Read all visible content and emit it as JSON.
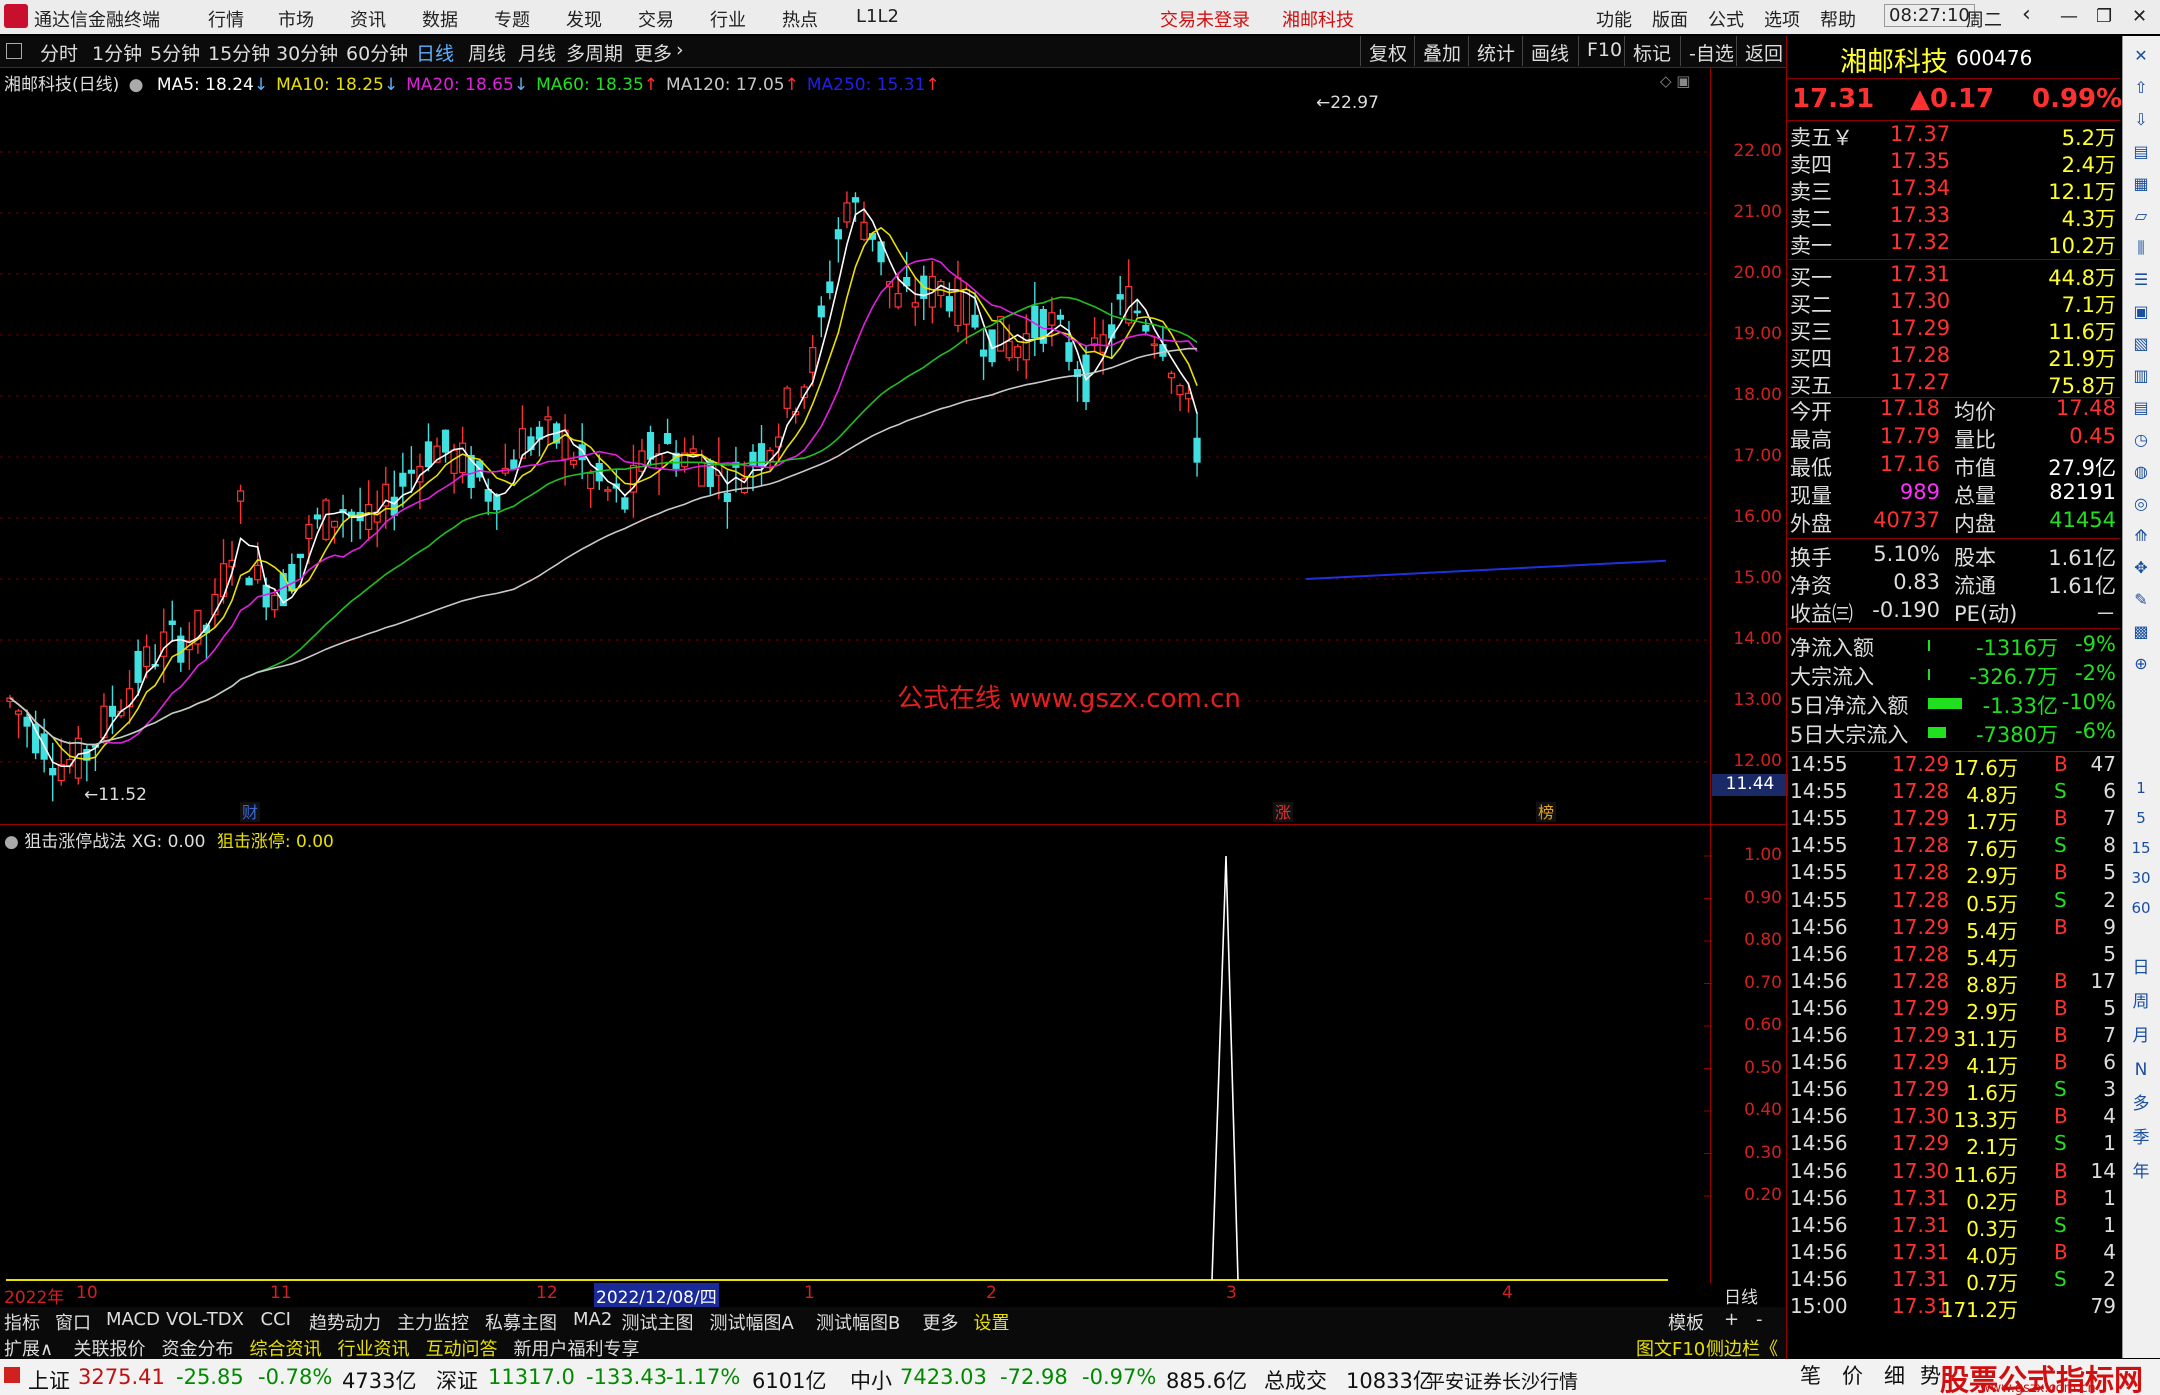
{
  "app": {
    "title": "通达信金融终端",
    "menu": [
      "行情",
      "市场",
      "资讯",
      "数据",
      "专题",
      "发现",
      "交易",
      "行业",
      "热点",
      "L1L2"
    ],
    "trade_status": "交易未登录",
    "stock_title": "湘邮科技",
    "right_menu": [
      "功能",
      "版面",
      "公式",
      "选项",
      "帮助"
    ],
    "time": "08:27:10",
    "weekday": "周二"
  },
  "periods": [
    "分时",
    "1分钟",
    "5分钟",
    "15分钟",
    "30分钟",
    "60分钟",
    "日线",
    "周线",
    "月线",
    "多周期",
    "更多"
  ],
  "active_period": "日线",
  "tools": [
    "复权",
    "叠加",
    "统计",
    "画线",
    "F10",
    "标记",
    "-自选",
    "返回"
  ],
  "main_chart": {
    "title": "湘邮科技(日线)",
    "ma": [
      {
        "label": "MA5: 18.24",
        "color": "#ffffff",
        "arrow": "↓"
      },
      {
        "label": "MA10: 18.25",
        "color": "#e8e000",
        "arrow": "↓"
      },
      {
        "label": "MA20: 18.65",
        "color": "#e020e0",
        "arrow": "↓"
      },
      {
        "label": "MA60: 18.35",
        "color": "#20e020",
        "arrow": "↑"
      },
      {
        "label": "MA120: 17.05",
        "color": "#c8c8c8",
        "arrow": "↑"
      },
      {
        "label": "MA250: 15.31",
        "color": "#2020e8",
        "arrow": "↑"
      }
    ],
    "high_label": "22.97",
    "low_label": "11.52",
    "price_tag": "11.44",
    "watermark": "公式在线  www.gszx.com.cn",
    "markers": [
      {
        "text": "财",
        "color": "#3a6ad8"
      },
      {
        "text": "涨",
        "color": "#e03030"
      },
      {
        "text": "榜",
        "color": "#e0a020"
      }
    ],
    "ylabels": [
      "22.00",
      "21.00",
      "20.00",
      "19.00",
      "18.00",
      "17.00",
      "16.00",
      "15.00",
      "14.00",
      "13.00",
      "12.00"
    ]
  },
  "sub_chart": {
    "title": "狙击涨停战法",
    "xg": "XG: 0.00",
    "signal": "狙击涨停: 0.00",
    "ylabels": [
      "1.00",
      "0.90",
      "0.80",
      "0.70",
      "0.60",
      "0.50",
      "0.40",
      "0.30",
      "0.20"
    ]
  },
  "xaxis": {
    "labels": [
      "2022年",
      "10",
      "11",
      "12",
      "2022/12/08/四",
      "1",
      "2",
      "3",
      "4"
    ],
    "right": "日线"
  },
  "tabs1": [
    "指标",
    "窗口",
    "MACD",
    "VOL-TDX",
    "CCI",
    "趋势动力",
    "主力监控",
    "私募主图",
    "MA2",
    "测试主图",
    "测试幅图A",
    "测试幅图B",
    "更多",
    "设置"
  ],
  "tabs1_right": [
    "模板",
    "+",
    "-"
  ],
  "tabs2": [
    "扩展∧",
    "关联报价",
    "资金分布",
    "综合资讯",
    "行业资讯",
    "互动问答",
    "新用户福利专享"
  ],
  "tabs2_right": [
    "图文F10",
    "侧边栏《",
    "笔",
    "价",
    "细",
    "势"
  ],
  "quote": {
    "name": "湘邮科技",
    "code": "600476",
    "price": "17.31",
    "change": "▲0.17",
    "pct": "0.99%",
    "sell": [
      {
        "l": "卖五￥",
        "p": "17.37",
        "v": "5.2万"
      },
      {
        "l": "卖四",
        "p": "17.35",
        "v": "2.4万"
      },
      {
        "l": "卖三",
        "p": "17.34",
        "v": "12.1万"
      },
      {
        "l": "卖二",
        "p": "17.33",
        "v": "4.3万"
      },
      {
        "l": "卖一",
        "p": "17.32",
        "v": "10.2万"
      }
    ],
    "buy": [
      {
        "l": "买一",
        "p": "17.31",
        "v": "44.8万"
      },
      {
        "l": "买二",
        "p": "17.30",
        "v": "7.1万"
      },
      {
        "l": "买三",
        "p": "17.29",
        "v": "11.6万"
      },
      {
        "l": "买四",
        "p": "17.28",
        "v": "21.9万"
      },
      {
        "l": "买五",
        "p": "17.27",
        "v": "75.8万"
      }
    ],
    "stats": [
      {
        "a": "今开",
        "b": "17.18",
        "c": "均价",
        "d": "17.48",
        "bc": "#ff3030",
        "dc": "#ff3030"
      },
      {
        "a": "最高",
        "b": "17.79",
        "c": "量比",
        "d": "0.45",
        "bc": "#ff3030",
        "dc": "#ff3030"
      },
      {
        "a": "最低",
        "b": "17.16",
        "c": "市值",
        "d": "27.9亿",
        "bc": "#ff3030",
        "dc": "#ffffff"
      },
      {
        "a": "现量",
        "b": "989",
        "c": "总量",
        "d": "82191",
        "bc": "#ff30ff",
        "dc": "#ffffff"
      },
      {
        "a": "外盘",
        "b": "40737",
        "c": "内盘",
        "d": "41454",
        "bc": "#ff3030",
        "dc": "#20e020"
      }
    ],
    "stats2": [
      {
        "a": "换手",
        "b": "5.10%",
        "c": "股本",
        "d": "1.61亿"
      },
      {
        "a": "净资",
        "b": "0.83",
        "c": "流通",
        "d": "1.61亿"
      },
      {
        "a": "收益㈢",
        "b": "-0.190",
        "c": "PE(动)",
        "d": "－"
      }
    ],
    "flow": [
      {
        "a": "净流入额",
        "v": "-1316万",
        "p": "-9%",
        "bar": 2
      },
      {
        "a": "大宗流入",
        "v": "-326.7万",
        "p": "-2%",
        "bar": 2
      },
      {
        "a": "5日净流入额",
        "v": "-1.33亿",
        "p": "-10%",
        "bar": 34
      },
      {
        "a": "5日大宗流入",
        "v": "-7380万",
        "p": "-6%",
        "bar": 18
      }
    ],
    "ticks": [
      [
        "14:55",
        "17.29",
        "17.6万",
        "B",
        "47"
      ],
      [
        "14:55",
        "17.28",
        "4.8万",
        "S",
        "6"
      ],
      [
        "14:55",
        "17.29",
        "1.7万",
        "B",
        "7"
      ],
      [
        "14:55",
        "17.28",
        "7.6万",
        "S",
        "8"
      ],
      [
        "14:55",
        "17.28",
        "2.9万",
        "B",
        "5"
      ],
      [
        "14:55",
        "17.28",
        "0.5万",
        "S",
        "2"
      ],
      [
        "14:56",
        "17.29",
        "5.4万",
        "B",
        "9"
      ],
      [
        "14:56",
        "17.28",
        "5.4万",
        "",
        "5"
      ],
      [
        "14:56",
        "17.28",
        "8.8万",
        "B",
        "17"
      ],
      [
        "14:56",
        "17.29",
        "2.9万",
        "B",
        "5"
      ],
      [
        "14:56",
        "17.29",
        "31.1万",
        "B",
        "7"
      ],
      [
        "14:56",
        "17.29",
        "4.1万",
        "B",
        "6"
      ],
      [
        "14:56",
        "17.29",
        "1.6万",
        "S",
        "3"
      ],
      [
        "14:56",
        "17.30",
        "13.3万",
        "B",
        "4"
      ],
      [
        "14:56",
        "17.29",
        "2.1万",
        "S",
        "1"
      ],
      [
        "14:56",
        "17.30",
        "11.6万",
        "B",
        "14"
      ],
      [
        "14:56",
        "17.31",
        "0.2万",
        "B",
        "1"
      ],
      [
        "14:56",
        "17.31",
        "0.3万",
        "S",
        "1"
      ],
      [
        "14:56",
        "17.31",
        "4.0万",
        "B",
        "4"
      ],
      [
        "14:56",
        "17.31",
        "0.7万",
        "S",
        "2"
      ],
      [
        "15:00",
        "17.31",
        "171.2万",
        "",
        "79"
      ]
    ]
  },
  "strip": [
    "日",
    "周",
    "月",
    "N",
    "多",
    "季",
    "年"
  ],
  "strip_nums": [
    "1",
    "5",
    "15",
    "30",
    "60"
  ],
  "status": {
    "sh_name": "上证",
    "sh": "3275.41",
    "sh_chg": "-25.85",
    "sh_pct": "-0.78%",
    "sh_amt": "4733亿",
    "sz_name": "深证",
    "sz": "11317.0",
    "sz_chg": "-133.43",
    "sz_pct": "-1.17%",
    "sz_amt": "6101亿",
    "zx_name": "中小",
    "zx": "7423.03",
    "zx_chg": "-72.98",
    "zx_pct": "-0.97%",
    "zx_amt": "885.6亿",
    "total_label": "总成交",
    "total": "10833亿",
    "broker": "平安证券长沙行情",
    "brand": "股票公式指标网",
    "brand_url": "www.gszx.com.cn"
  }
}
